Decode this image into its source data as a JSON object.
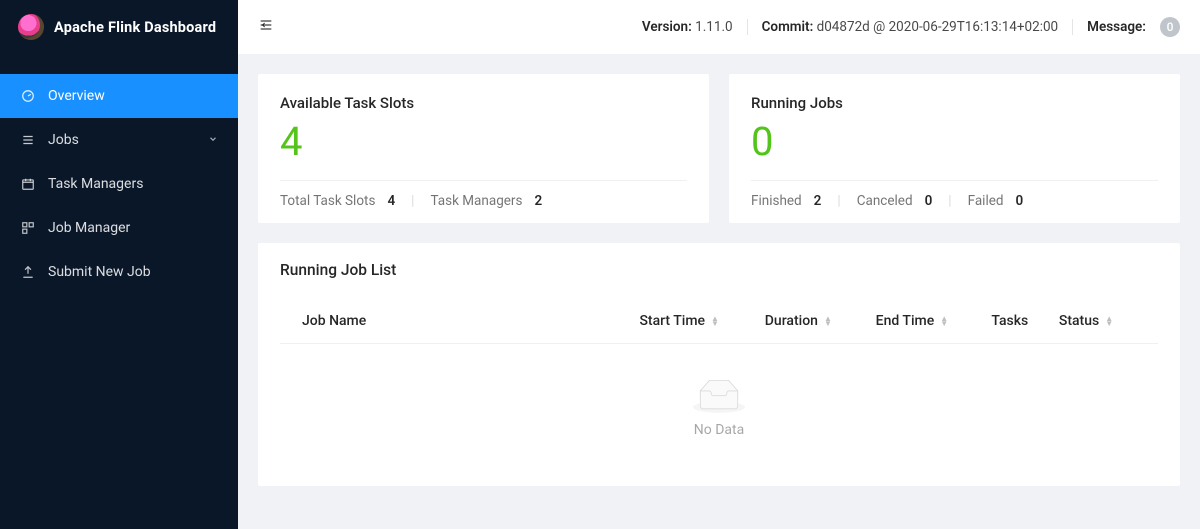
{
  "brand": {
    "title": "Apache Flink Dashboard"
  },
  "sidebar": {
    "items": [
      {
        "label": "Overview"
      },
      {
        "label": "Jobs"
      },
      {
        "label": "Task Managers"
      },
      {
        "label": "Job Manager"
      },
      {
        "label": "Submit New Job"
      }
    ]
  },
  "topbar": {
    "version_label": "Version:",
    "version_value": "1.11.0",
    "commit_label": "Commit:",
    "commit_value": "d04872d @ 2020-06-29T16:13:14+02:00",
    "message_label": "Message:",
    "message_count": "0"
  },
  "slots_card": {
    "title": "Available Task Slots",
    "value": "4",
    "total_label": "Total Task Slots",
    "total_value": "4",
    "tm_label": "Task Managers",
    "tm_value": "2"
  },
  "jobs_card": {
    "title": "Running Jobs",
    "value": "0",
    "finished_label": "Finished",
    "finished_value": "2",
    "canceled_label": "Canceled",
    "canceled_value": "0",
    "failed_label": "Failed",
    "failed_value": "0"
  },
  "joblist": {
    "title": "Running Job List",
    "columns": {
      "job": "Job Name",
      "start": "Start Time",
      "dur": "Duration",
      "end": "End Time",
      "tasks": "Tasks",
      "status": "Status"
    },
    "empty_text": "No Data"
  }
}
